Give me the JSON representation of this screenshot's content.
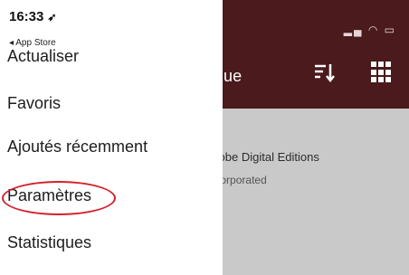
{
  "status_bar": {
    "time": "16:33",
    "location_arrow": "location-arrow-icon",
    "back_app": "◂ App Store",
    "right_icons": "signal-wifi-battery"
  },
  "app_header": {
    "title": "Bibliothèque",
    "background_color": "#4a1a1c"
  },
  "book": {
    "title": "Lire avec Adobe Digital Editions",
    "author": "Adobe Systems Incorporated"
  },
  "drawer": {
    "items": [
      {
        "label": "Actualiser"
      },
      {
        "label": "Favoris"
      },
      {
        "label": "Ajoutés récemment"
      },
      {
        "label": "Paramètres"
      },
      {
        "label": "Statistiques"
      }
    ]
  },
  "annotation": {
    "highlight_color": "#d4202a",
    "highlighted_item": "Paramètres"
  }
}
